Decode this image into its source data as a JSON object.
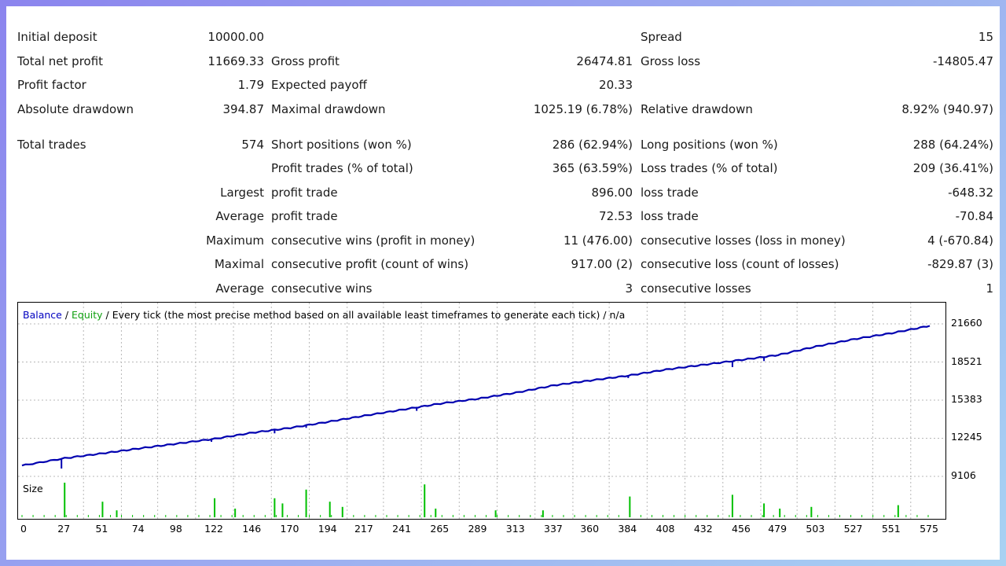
{
  "stats": {
    "initial_deposit": {
      "label": "Initial deposit",
      "value": "10000.00"
    },
    "spread": {
      "label": "Spread",
      "value": "15"
    },
    "total_net_profit": {
      "label": "Total net profit",
      "value": "11669.33"
    },
    "gross_profit": {
      "label": "Gross profit",
      "value": "26474.81"
    },
    "gross_loss": {
      "label": "Gross loss",
      "value": "-14805.47"
    },
    "profit_factor": {
      "label": "Profit factor",
      "value": "1.79"
    },
    "expected_payoff": {
      "label": "Expected payoff",
      "value": "20.33"
    },
    "absolute_drawdown": {
      "label": "Absolute drawdown",
      "value": "394.87"
    },
    "maximal_drawdown": {
      "label": "Maximal drawdown",
      "value": "1025.19 (6.78%)"
    },
    "relative_drawdown": {
      "label": "Relative drawdown",
      "value": "8.92% (940.97)"
    },
    "total_trades": {
      "label": "Total trades",
      "value": "574"
    },
    "short_positions": {
      "label": "Short positions (won %)",
      "value": "286 (62.94%)"
    },
    "long_positions": {
      "label": "Long positions (won %)",
      "value": "288 (64.24%)"
    },
    "profit_trades": {
      "label": "Profit trades (% of total)",
      "value": "365 (63.59%)"
    },
    "loss_trades": {
      "label": "Loss trades (% of total)",
      "value": "209 (36.41%)"
    },
    "largest": {
      "row_label": "Largest",
      "profit_label": "profit trade",
      "profit_value": "896.00",
      "loss_label": "loss trade",
      "loss_value": "-648.32"
    },
    "average": {
      "row_label": "Average",
      "profit_label": "profit trade",
      "profit_value": "72.53",
      "loss_label": "loss trade",
      "loss_value": "-70.84"
    },
    "maximum": {
      "row_label": "Maximum",
      "profit_label": "consecutive wins (profit in money)",
      "profit_value": "11 (476.00)",
      "loss_label": "consecutive losses (loss in money)",
      "loss_value": "4 (-670.84)"
    },
    "maximal": {
      "row_label": "Maximal",
      "profit_label": "consecutive profit (count of wins)",
      "profit_value": "917.00 (2)",
      "loss_label": "consecutive loss (count of losses)",
      "loss_value": "-829.87 (3)"
    },
    "average_consec": {
      "row_label": "Average",
      "profit_label": "consecutive wins",
      "profit_value": "3",
      "loss_label": "consecutive losses",
      "loss_value": "1"
    }
  },
  "chart_data": {
    "type": "line",
    "legend": {
      "balance": "Balance",
      "sep1": " / ",
      "equity": "Equity",
      "rest": " / Every tick (the most precise method based on all available least timeframes to generate each tick) / n/a"
    },
    "size_label": "Size",
    "y_ticks": [
      "21660",
      "18521",
      "15383",
      "12245",
      "9106"
    ],
    "y_tick_values": [
      21660,
      18521,
      15383,
      12245,
      9106
    ],
    "x_ticks": [
      "0",
      "27",
      "51",
      "74",
      "98",
      "122",
      "146",
      "170",
      "194",
      "217",
      "241",
      "265",
      "289",
      "313",
      "337",
      "360",
      "384",
      "408",
      "432",
      "456",
      "479",
      "503",
      "527",
      "551",
      "575"
    ],
    "x_tick_values": [
      0,
      27,
      51,
      74,
      98,
      122,
      146,
      170,
      194,
      217,
      241,
      265,
      289,
      313,
      337,
      360,
      384,
      408,
      432,
      456,
      479,
      503,
      527,
      551,
      575
    ],
    "xlim": [
      0,
      575
    ],
    "ylim": [
      9106,
      21660
    ],
    "colors": {
      "balance": "#0000b0",
      "equity": "#10a010",
      "grid": "#b8b8b8",
      "size": "#00c000"
    },
    "series": [
      {
        "name": "Balance",
        "x": [
          0,
          27,
          51,
          74,
          98,
          122,
          146,
          170,
          194,
          217,
          241,
          265,
          289,
          313,
          337,
          360,
          384,
          408,
          432,
          456,
          479,
          503,
          527,
          551,
          575
        ],
        "values": [
          10000,
          10600,
          11000,
          11400,
          11800,
          12200,
          12700,
          13100,
          13600,
          14100,
          14600,
          15100,
          15500,
          16000,
          16600,
          17000,
          17400,
          17900,
          18300,
          18700,
          19100,
          19800,
          20400,
          20900,
          21500
        ]
      }
    ],
    "dips": [
      {
        "x": 25,
        "value": 9750
      },
      {
        "x": 120,
        "value": 11950
      },
      {
        "x": 160,
        "value": 12650
      },
      {
        "x": 180,
        "value": 13100
      },
      {
        "x": 250,
        "value": 14500
      },
      {
        "x": 384,
        "value": 17200
      },
      {
        "x": 450,
        "value": 18100
      },
      {
        "x": 470,
        "value": 18600
      }
    ],
    "size_bars": [
      {
        "x": 27,
        "value": 1.0
      },
      {
        "x": 51,
        "value": 0.45
      },
      {
        "x": 60,
        "value": 0.2
      },
      {
        "x": 122,
        "value": 0.55
      },
      {
        "x": 135,
        "value": 0.25
      },
      {
        "x": 160,
        "value": 0.55
      },
      {
        "x": 165,
        "value": 0.4
      },
      {
        "x": 180,
        "value": 0.8
      },
      {
        "x": 195,
        "value": 0.45
      },
      {
        "x": 203,
        "value": 0.3
      },
      {
        "x": 255,
        "value": 0.95
      },
      {
        "x": 262,
        "value": 0.25
      },
      {
        "x": 300,
        "value": 0.2
      },
      {
        "x": 330,
        "value": 0.2
      },
      {
        "x": 385,
        "value": 0.6
      },
      {
        "x": 450,
        "value": 0.65
      },
      {
        "x": 470,
        "value": 0.4
      },
      {
        "x": 480,
        "value": 0.25
      },
      {
        "x": 500,
        "value": 0.3
      },
      {
        "x": 555,
        "value": 0.35
      }
    ]
  }
}
